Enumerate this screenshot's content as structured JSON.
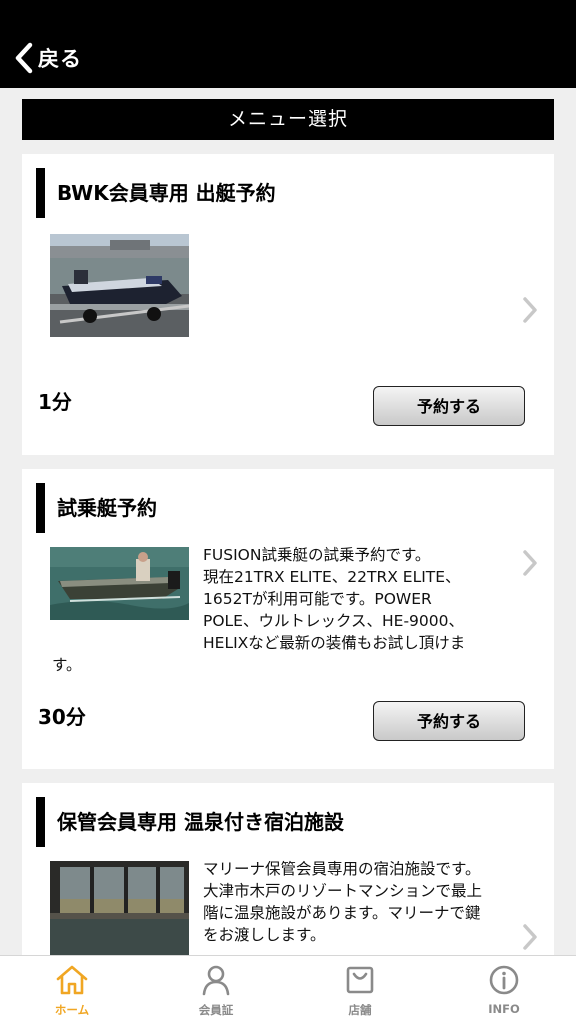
{
  "nav": {
    "back_label": "戻る"
  },
  "section_header": "メニュー選択",
  "colors": {
    "accent": "#f0a623",
    "header": "#000000",
    "inactive": "#8a8a8a"
  },
  "menus": [
    {
      "title": "BWK会員専用 出艇予約",
      "image": "bass-boat-on-trailer",
      "description": "",
      "duration": "1分",
      "button_label": "予約する"
    },
    {
      "title": "試乗艇予約",
      "image": "test-boat-on-water",
      "description_lines": [
        "FUSION試乗艇の試乗予約です。",
        "現在21TRX ELITE、22TRX ELITE、",
        "1652Tが利用可能です。POWER",
        "POLE、ウルトレックス、HE-9000、",
        "HELIXなど最新の装備もお試し頂けま",
        "す。"
      ],
      "duration": "30分",
      "button_label": "予約する"
    },
    {
      "title": "保管会員専用 温泉付き宿泊施設",
      "image": "hot-spring-bath",
      "description_lines": [
        "マリーナ保管会員専用の宿泊施設です。",
        "大津市木戸のリゾートマンションで最上",
        "階に温泉施設があります。マリーナで鍵",
        "をお渡しします。"
      ]
    }
  ],
  "tabs": [
    {
      "label": "ホーム",
      "icon": "home-icon",
      "active": true
    },
    {
      "label": "会員証",
      "icon": "person-icon",
      "active": false
    },
    {
      "label": "店舗",
      "icon": "store-icon",
      "active": false
    },
    {
      "label": "INFO",
      "icon": "info-icon",
      "active": false
    }
  ]
}
